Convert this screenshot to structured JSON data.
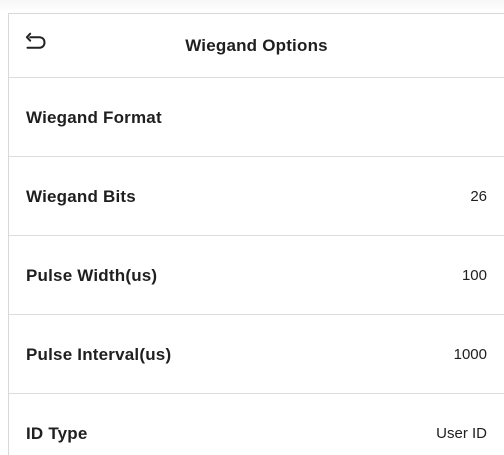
{
  "header": {
    "title": "Wiegand Options",
    "back_icon": "back-arrow-icon"
  },
  "settings": [
    {
      "label": "Wiegand Format",
      "value": ""
    },
    {
      "label": "Wiegand Bits",
      "value": "26"
    },
    {
      "label": "Pulse Width(us)",
      "value": "100"
    },
    {
      "label": "Pulse Interval(us)",
      "value": "1000"
    },
    {
      "label": "ID Type",
      "value": "User ID"
    }
  ],
  "colors": {
    "text": "#1f1f1f",
    "divider": "#dddddd",
    "background": "#ffffff"
  }
}
